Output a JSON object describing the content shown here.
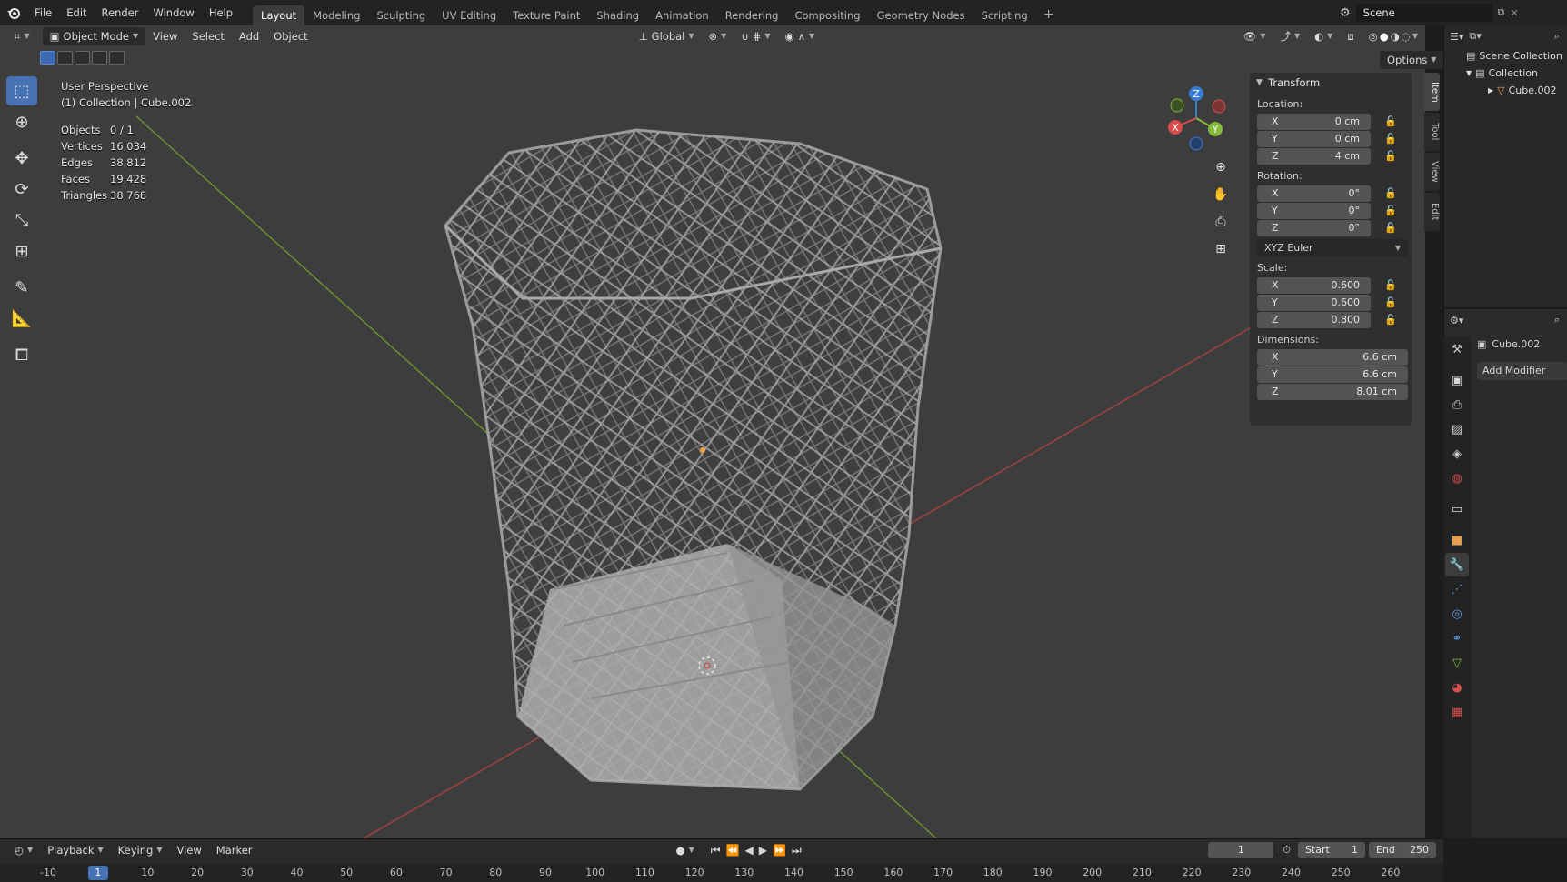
{
  "app": {
    "logo_icon": "blender-logo-icon"
  },
  "menu": [
    "File",
    "Edit",
    "Render",
    "Window",
    "Help"
  ],
  "workspaces": [
    "Layout",
    "Modeling",
    "Sculpting",
    "UV Editing",
    "Texture Paint",
    "Shading",
    "Animation",
    "Rendering",
    "Compositing",
    "Geometry Nodes",
    "Scripting"
  ],
  "active_workspace": "Layout",
  "scene": {
    "name": "Scene"
  },
  "viewport_header": {
    "mode": "Object Mode",
    "menus": [
      "View",
      "Select",
      "Add",
      "Object"
    ],
    "transform_orientation": "Global",
    "options_label": "Options"
  },
  "viewport_overlay": {
    "perspective": "User Perspective",
    "collection_object": "(1) Collection | Cube.002",
    "stats": [
      {
        "label": "Objects",
        "value": "0 / 1"
      },
      {
        "label": "Vertices",
        "value": "16,034"
      },
      {
        "label": "Edges",
        "value": "38,812"
      },
      {
        "label": "Faces",
        "value": "19,428"
      },
      {
        "label": "Triangles",
        "value": "38,768"
      }
    ]
  },
  "gizmo": {
    "x": "X",
    "y": "Y",
    "z": "Z"
  },
  "npanel": {
    "title": "Transform",
    "location_label": "Location:",
    "location": {
      "x": "0 cm",
      "y": "0 cm",
      "z": "4 cm"
    },
    "rotation_label": "Rotation:",
    "rotation": {
      "x": "0°",
      "y": "0°",
      "z": "0°"
    },
    "rotation_mode": "XYZ Euler",
    "scale_label": "Scale:",
    "scale": {
      "x": "0.600",
      "y": "0.600",
      "z": "0.800"
    },
    "dimensions_label": "Dimensions:",
    "dimensions": {
      "x": "6.6 cm",
      "y": "6.6 cm",
      "z": "8.01 cm"
    },
    "axis": {
      "x": "X",
      "y": "Y",
      "z": "Z"
    },
    "tabs": [
      "Item",
      "Tool",
      "View",
      "Edit"
    ]
  },
  "outliner": {
    "rows": [
      {
        "label": "Scene Collection"
      },
      {
        "label": "Collection"
      },
      {
        "label": "Cube.002"
      }
    ]
  },
  "properties": {
    "object_name": "Cube.002",
    "add_modifier": "Add Modifier"
  },
  "timeline": {
    "menus": [
      "Playback",
      "Keying",
      "View",
      "Marker"
    ],
    "current_frame": "1",
    "start_label": "Start",
    "start": "1",
    "end_label": "End",
    "end": "250",
    "ruler": [
      "-10",
      "1",
      "10",
      "20",
      "30",
      "40",
      "50",
      "60",
      "70",
      "80",
      "90",
      "100",
      "110",
      "120",
      "130",
      "140",
      "150",
      "160",
      "170",
      "180",
      "190",
      "200",
      "210",
      "220",
      "230",
      "240",
      "250",
      "260"
    ]
  },
  "colors": {
    "accent": "#4772b3",
    "x_axis": "#d94c4c",
    "y_axis": "#86b83c",
    "z_axis": "#3a7bd5"
  }
}
